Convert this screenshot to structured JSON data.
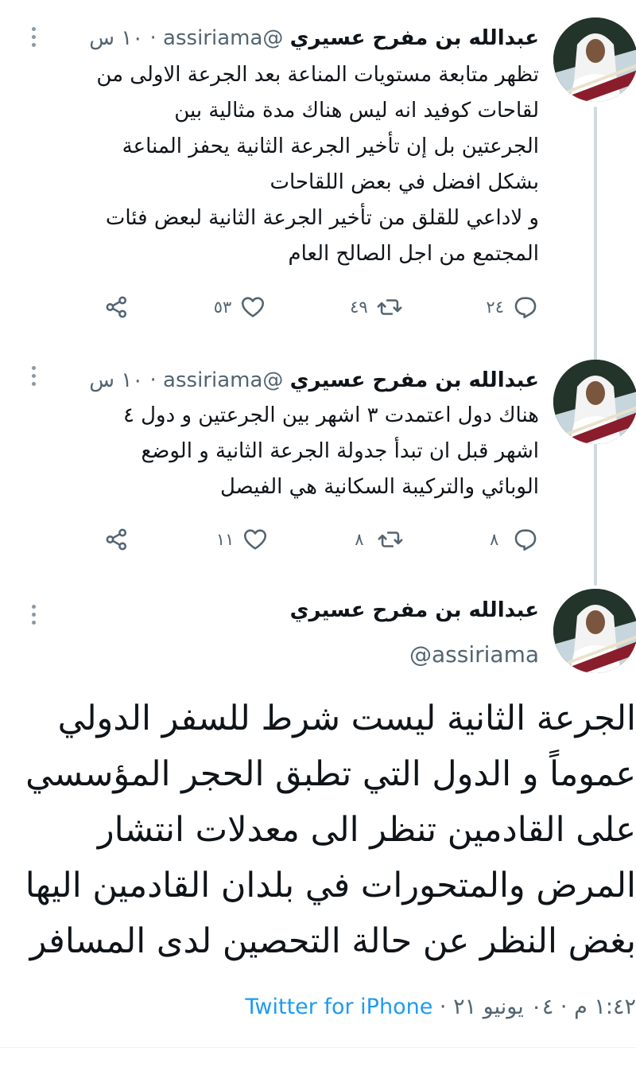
{
  "tweets": [
    {
      "name": "عبدالله بن مفرح عسيري",
      "handle": "@assiriama",
      "dot": "·",
      "time": "١٠ س",
      "text": "تظهر متابعة مستويات المناعة بعد الجرعة الاولى من\nلقاحات كوفيد انه ليس هناك مدة مثالية بين\nالجرعتين بل إن تأخير الجرعة الثانية يحفز المناعة\nبشكل افضل في بعض اللقاحات\nو لاداعي للقلق من تأخير الجرعة الثانية لبعض فئات\nالمجتمع من اجل الصالح العام",
      "replies": "٢٤",
      "retweets": "٤٩",
      "likes": "٥٣"
    },
    {
      "name": "عبدالله بن مفرح عسيري",
      "handle": "@assiriama",
      "dot": "·",
      "time": "١٠ س",
      "text": "هناك دول اعتمدت ٣ اشهر بين الجرعتين و دول ٤\nاشهر قبل ان تبدأ جدولة الجرعة الثانية و الوضع\nالوبائي والتركيبة السكانية هي الفيصل",
      "replies": "٨",
      "retweets": "٨",
      "likes": "١١"
    }
  ],
  "main_tweet": {
    "name": "عبدالله بن مفرح عسيري",
    "handle": "@assiriama",
    "text": "الجرعة الثانية ليست شرط للسفر الدولي\nعموماً و الدول التي تطبق الحجر المؤسسي\nعلى القادمين تنظر الى معدلات انتشار\nالمرض والمتحورات في بلدان القادمين اليها\nبغض النظر عن حالة التحصين لدى المسافر",
    "timestamp": "١:٤٢ م · ٠٤ يونيو ٢١ · ",
    "source": "Twitter for iPhone"
  },
  "icons": {
    "more": "more-vertical-icon",
    "reply": "reply-icon",
    "retweet": "retweet-icon",
    "like": "heart-icon",
    "share": "share-icon"
  },
  "colors": {
    "text": "#0f1419",
    "secondary": "#536471",
    "link": "#1d9bf0",
    "thread_line": "#cfd9de"
  }
}
